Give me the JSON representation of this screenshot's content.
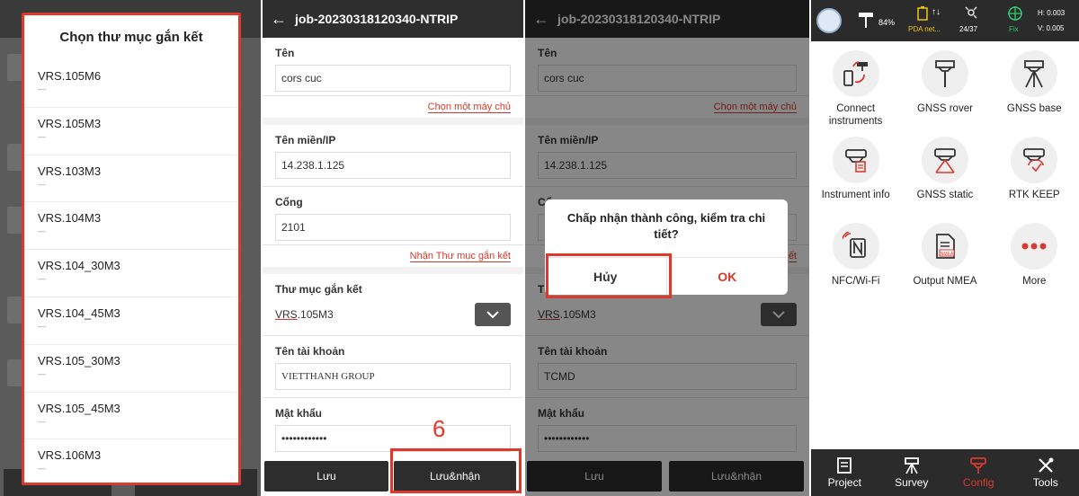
{
  "panel1": {
    "title": "Chọn thư mục gắn kết",
    "items": [
      {
        "name": "VRS.105M6",
        "sub": "—"
      },
      {
        "name": "VRS.105M3",
        "sub": "—"
      },
      {
        "name": "VRS.103M3",
        "sub": "—"
      },
      {
        "name": "VRS.104M3",
        "sub": "—"
      },
      {
        "name": "VRS.104_30M3",
        "sub": "—"
      },
      {
        "name": "VRS.104_45M3",
        "sub": "—"
      },
      {
        "name": "VRS.105_30M3",
        "sub": "—"
      },
      {
        "name": "VRS.105_45M3",
        "sub": "—"
      },
      {
        "name": "VRS.106M3",
        "sub": "—"
      }
    ]
  },
  "panel2": {
    "back_icon": "←",
    "title": "job-20230318120340-NTRIP",
    "name_label": "Tên",
    "name_value": "cors cuc",
    "choose_server_link": "Chọn một máy chủ",
    "domain_label": "Tên miền/IP",
    "domain_value": "14.238.1.125",
    "port_label": "Cổng",
    "port_value": "2101",
    "get_mount_link": "Nhận Thư mục gắn kết",
    "mount_label": "Thư mục gắn kết",
    "mount_value_prefix": "VRS",
    "mount_value_suffix": ".105M3",
    "account_label": "Tên tài khoản",
    "account_value": "VIETTHANH GROUP",
    "password_label": "Mật khẩu",
    "password_value": "••••••••••••",
    "save_button": "Lưu",
    "save_receive_button": "Lưu&nhận",
    "step_number": "6"
  },
  "panel3": {
    "back_icon": "←",
    "title": "job-20230318120340-NTRIP",
    "name_label": "Tên",
    "name_value": "cors cuc",
    "choose_server_link": "Chọn một máy chủ",
    "domain_label": "Tên miền/IP",
    "domain_value": "14.238.1.125",
    "port_label": "Cổng",
    "port_value": "",
    "get_mount_link": "ết",
    "mount_label": "T",
    "mount_value_prefix": "VRS",
    "mount_value_suffix": ".105M3",
    "account_label": "Tên tài khoản",
    "account_value": "TCMD",
    "password_label": "Mật khẩu",
    "password_value": "••••••••••••",
    "save_button": "Lưu",
    "save_receive_button": "Lưu&nhận",
    "dialog": {
      "message": "Chấp nhận thành công, kiểm tra chi tiết?",
      "cancel": "Hủy",
      "ok": "OK"
    }
  },
  "panel4": {
    "status": {
      "battery": "84%",
      "pda": "PDA net...",
      "sats": "24/37",
      "fix": "Fix",
      "h": "H: 0.003",
      "v": "V: 0.005"
    },
    "tiles": [
      {
        "label": "Connect instruments",
        "icon": "connect-instruments-icon"
      },
      {
        "label": "GNSS rover",
        "icon": "gnss-rover-icon"
      },
      {
        "label": "GNSS base",
        "icon": "gnss-base-icon"
      },
      {
        "label": "Instrument info",
        "icon": "instrument-info-icon"
      },
      {
        "label": "GNSS static",
        "icon": "gnss-static-icon"
      },
      {
        "label": "RTK KEEP",
        "icon": "rtk-keep-icon"
      },
      {
        "label": "NFC/Wi-Fi",
        "icon": "nfc-wifi-icon"
      },
      {
        "label": "Output NMEA",
        "icon": "output-nmea-icon"
      },
      {
        "label": "More",
        "icon": "more-icon"
      }
    ],
    "tabs": [
      {
        "label": "Project",
        "icon": "project-icon"
      },
      {
        "label": "Survey",
        "icon": "survey-icon"
      },
      {
        "label": "Config",
        "icon": "config-icon",
        "active": true
      },
      {
        "label": "Tools",
        "icon": "tools-icon"
      }
    ],
    "accent": "#d93a30"
  }
}
